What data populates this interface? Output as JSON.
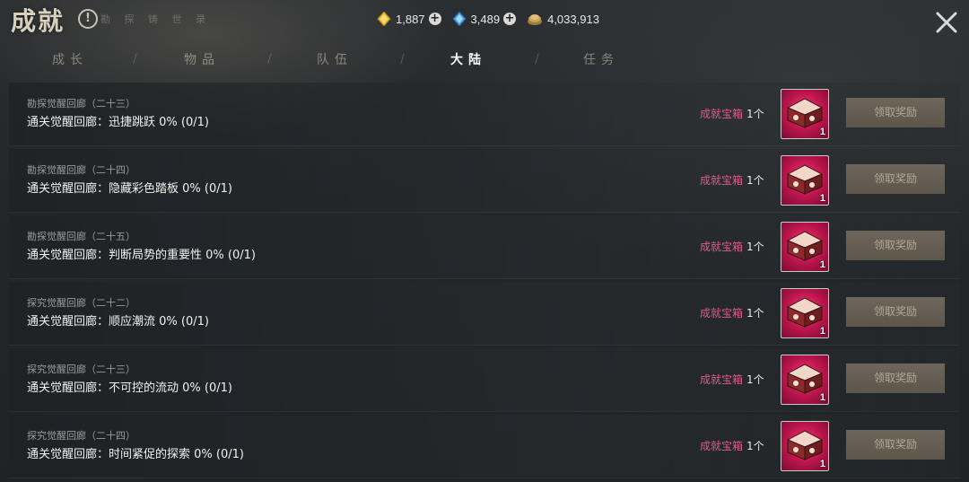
{
  "header": {
    "title": "成就",
    "info_icon": "!",
    "caption": "勘 探 铸 世 录",
    "currencies": [
      {
        "icon": "gold-gem-icon",
        "value": "1,887",
        "color": "#e9c23a"
      },
      {
        "icon": "blue-gem-icon",
        "value": "3,489",
        "color": "#4aa3e8"
      },
      {
        "icon": "coin-pile-icon",
        "value": "4,033,913",
        "color": "#c9a25a"
      }
    ]
  },
  "tabs": [
    {
      "label": "成长",
      "active": false
    },
    {
      "label": "物品",
      "active": false
    },
    {
      "label": "队伍",
      "active": false
    },
    {
      "label": "大陆",
      "active": true
    },
    {
      "label": "任务",
      "active": false
    }
  ],
  "tab_separator": "/",
  "rows": [
    {
      "subtitle": "勘探觉醒回廊（二十三）",
      "title": "通关觉醒回廊：迅捷跳跃 0% (0/1)",
      "reward": "成就宝箱",
      "reward_qty": "1个",
      "item_count": "1",
      "button": "领取奖励"
    },
    {
      "subtitle": "勘探觉醒回廊（二十四）",
      "title": "通关觉醒回廊：隐藏彩色踏板 0% (0/1)",
      "reward": "成就宝箱",
      "reward_qty": "1个",
      "item_count": "1",
      "button": "领取奖励"
    },
    {
      "subtitle": "勘探觉醒回廊（二十五）",
      "title": "通关觉醒回廊：判断局势的重要性 0% (0/1)",
      "reward": "成就宝箱",
      "reward_qty": "1个",
      "item_count": "1",
      "button": "领取奖励"
    },
    {
      "subtitle": "探究觉醒回廊（二十二）",
      "title": "通关觉醒回廊：顺应潮流 0% (0/1)",
      "reward": "成就宝箱",
      "reward_qty": "1个",
      "item_count": "1",
      "button": "领取奖励"
    },
    {
      "subtitle": "探究觉醒回廊（二十三）",
      "title": "通关觉醒回廊：不可控的流动 0% (0/1)",
      "reward": "成就宝箱",
      "reward_qty": "1个",
      "item_count": "1",
      "button": "领取奖励"
    },
    {
      "subtitle": "探究觉醒回廊（二十四）",
      "title": "通关觉醒回廊：时间紧促的探索 0% (0/1)",
      "reward": "成就宝箱",
      "reward_qty": "1个",
      "item_count": "1",
      "button": "领取奖励"
    }
  ],
  "colors": {
    "reward_text": "#e15a86",
    "chest_bg": "#b8144b",
    "button_bg": "#5c564b"
  }
}
